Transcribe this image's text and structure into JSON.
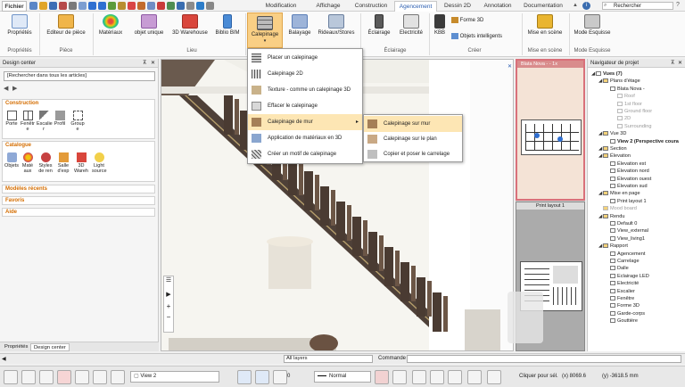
{
  "tabs": {
    "file": "Fichier",
    "items": [
      "Modification",
      "Affichage",
      "Construction",
      "Agencement",
      "Dessin 2D",
      "Annotation",
      "Documentation"
    ],
    "search_placeholder": "Rechercher"
  },
  "ribbon": {
    "buttons": [
      {
        "label": "Propriétés"
      },
      {
        "label": "Editeur de pièce"
      },
      {
        "label": "Matériaux"
      },
      {
        "label": "objet unique"
      },
      {
        "label": "3D Warehouse"
      },
      {
        "label": "Biblio BIM"
      },
      {
        "label": "Calepinage"
      },
      {
        "label": "Balayage"
      },
      {
        "label": "Rideaux/Stores"
      },
      {
        "label": "Éclairage"
      },
      {
        "label": "Electricité"
      },
      {
        "label": "KBB"
      },
      {
        "label": "Forme 3D"
      },
      {
        "label": "Objets intelligents"
      },
      {
        "label": "Mise en scène"
      },
      {
        "label": "Mode Esquisse"
      }
    ],
    "groups": [
      "Propriétés",
      "Pièce",
      "Lieu",
      "Éclairage",
      "Créer",
      "Mise en scène",
      "Mode Esquisse"
    ]
  },
  "menu": {
    "items": [
      "Placer un calepinage",
      "Calepinage 2D",
      "Texture - comme un calepinage 3D",
      "Effacer le calepinage",
      "Calepinage de mur",
      "Application de matériaux en 3D",
      "Créer un motif de calepinage"
    ],
    "submenu": [
      "Calepinage sur mur",
      "Calepinage sur le plan",
      "Copier et poser le carrelage"
    ]
  },
  "left_panel": {
    "title": "Design center",
    "search_placeholder": "[Rechercher dans tous les articles]",
    "construction": {
      "title": "Construction",
      "items": [
        "Porte",
        "Fenêtr e",
        "Escalie r",
        "Profil",
        "Group e"
      ]
    },
    "catalogue": {
      "title": "Catalogue",
      "items": [
        "Objets",
        "Maté aux",
        "Styles de ren",
        "Salle d'exp",
        "3D Wareh",
        "Light source"
      ]
    },
    "collapsed": [
      "Modèles récents",
      "Favoris",
      "Aide"
    ],
    "bottom_tabs": [
      "Propriétés",
      "Design center"
    ]
  },
  "thumbs": {
    "top_label": "Blata Nova - - 1x",
    "bottom_label": "Print layout 1"
  },
  "navigator": {
    "title": "Navigateur de projet",
    "items": [
      {
        "label": "Vues (7)",
        "bold": true,
        "level": 0
      },
      {
        "label": "Plans d'étage",
        "level": 1
      },
      {
        "label": "Blata Nova -",
        "level": 2
      },
      {
        "label": "Roof",
        "level": 3,
        "muted": true
      },
      {
        "label": "1st floor",
        "level": 3,
        "muted": true
      },
      {
        "label": "Ground floor",
        "level": 3,
        "muted": true
      },
      {
        "label": "2D",
        "level": 3,
        "muted": true
      },
      {
        "label": "Surrounding",
        "level": 3,
        "muted": true
      },
      {
        "label": "Vue 3D",
        "level": 1
      },
      {
        "label": "View 2 (Perspective coura",
        "bold": true,
        "level": 2
      },
      {
        "label": "Section",
        "level": 1
      },
      {
        "label": "Élevation",
        "level": 1
      },
      {
        "label": "Élevation est",
        "level": 2
      },
      {
        "label": "Élevation nord",
        "level": 2
      },
      {
        "label": "Élevation ouest",
        "level": 2
      },
      {
        "label": "Élevation sud",
        "level": 2
      },
      {
        "label": "Mise en page",
        "level": 1
      },
      {
        "label": "Print layout 1",
        "level": 2
      },
      {
        "label": "Mood board",
        "level": 1,
        "muted": true
      },
      {
        "label": "Rendu",
        "level": 1
      },
      {
        "label": "Default 0",
        "level": 2
      },
      {
        "label": "View_external",
        "level": 2
      },
      {
        "label": "View_living1",
        "level": 2
      },
      {
        "label": "Rapport",
        "level": 1
      },
      {
        "label": "Agencement",
        "level": 2
      },
      {
        "label": "Carrelage",
        "level": 2
      },
      {
        "label": "Dalle",
        "level": 2
      },
      {
        "label": "Eclairage LED",
        "level": 2
      },
      {
        "label": "Electricité",
        "level": 2
      },
      {
        "label": "Escalier",
        "level": 2
      },
      {
        "label": "Fenêtre",
        "level": 2
      },
      {
        "label": "Forme 3D",
        "level": 2
      },
      {
        "label": "Garde-corps",
        "level": 2
      },
      {
        "label": "Gouttière",
        "level": 2
      }
    ]
  },
  "cmdbar": {
    "layers": "All layers",
    "command_label": "Commande :"
  },
  "status": {
    "view": "View 2",
    "scale_value": "0",
    "line_style": "Normal",
    "snap": "Cliquer pour sél.",
    "x": "(x) 8069.6",
    "y": "(y) -3618.5 mm"
  },
  "colors": {
    "accent_orange": "#d46d00",
    "highlight": "#fde6b4",
    "tab_blue": "#2a5db0"
  }
}
